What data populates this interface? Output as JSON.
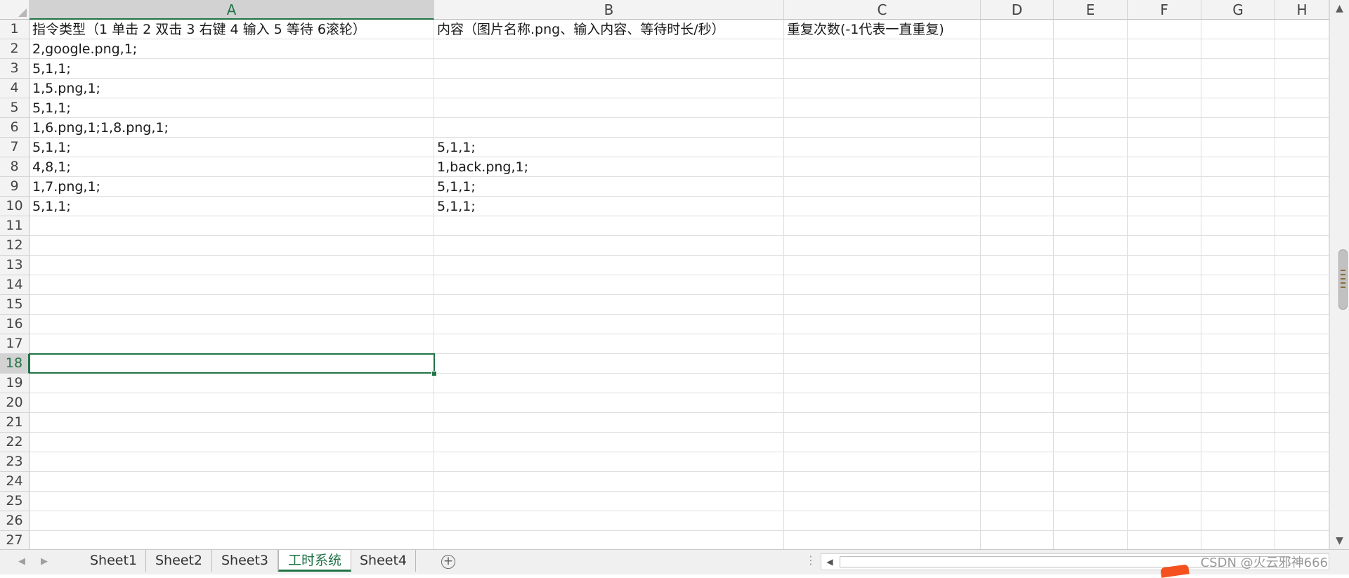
{
  "columns": [
    "A",
    "B",
    "C",
    "D",
    "E",
    "F",
    "G",
    "H"
  ],
  "selected_column": "A",
  "rows": [
    "1",
    "2",
    "3",
    "4",
    "5",
    "6",
    "7",
    "8",
    "9",
    "10",
    "11",
    "12",
    "13",
    "14",
    "15",
    "16",
    "17",
    "18",
    "19",
    "20",
    "21",
    "22",
    "23",
    "24",
    "25",
    "26",
    "27"
  ],
  "selected_row": "18",
  "cells": {
    "A1": "指令类型（1 单击  2 双击  3 右键  4 输入  5 等待  6滚轮）",
    "B1": "内容（图片名称.png、输入内容、等待时长/秒）",
    "C1": "重复次数(-1代表一直重复)",
    "A2": "2,google.png,1;",
    "A3": "5,1,1;",
    "A4": "1,5.png,1;",
    "A5": "5,1,1;",
    "A6": "1,6.png,1;1,8.png,1;",
    "A7": "5,1,1;",
    "B7": "5,1,1;",
    "A8": "4,8,1;",
    "B8": "1,back.png,1;",
    "A9": "1,7.png,1;",
    "B9": "5,1,1;",
    "A10": "5,1,1;",
    "B10": "5,1,1;"
  },
  "tabs": [
    "Sheet1",
    "Sheet2",
    "Sheet3",
    "工时系统",
    "Sheet4"
  ],
  "active_tab": "工时系统",
  "watermark": "CSDN @火云邪神666",
  "accent_color": "#217346"
}
